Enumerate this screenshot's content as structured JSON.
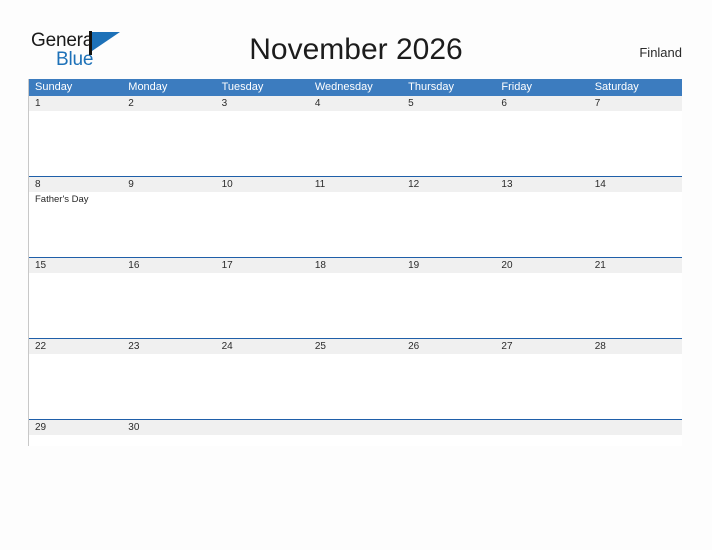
{
  "brand": {
    "name_part1": "General",
    "name_part2": "Blue",
    "logo_icon": "flag-triangle-icon"
  },
  "header": {
    "title": "November 2026",
    "locale": "Finland"
  },
  "calendar": {
    "weekdays": [
      "Sunday",
      "Monday",
      "Tuesday",
      "Wednesday",
      "Thursday",
      "Friday",
      "Saturday"
    ],
    "header_color": "#3c7cbf",
    "row_rule_color": "#1f5fa9",
    "date_band_color": "#f0f0f0",
    "weeks": [
      {
        "days": [
          {
            "date": "1",
            "event": ""
          },
          {
            "date": "2",
            "event": ""
          },
          {
            "date": "3",
            "event": ""
          },
          {
            "date": "4",
            "event": ""
          },
          {
            "date": "5",
            "event": ""
          },
          {
            "date": "6",
            "event": ""
          },
          {
            "date": "7",
            "event": ""
          }
        ]
      },
      {
        "days": [
          {
            "date": "8",
            "event": "Father's Day"
          },
          {
            "date": "9",
            "event": ""
          },
          {
            "date": "10",
            "event": ""
          },
          {
            "date": "11",
            "event": ""
          },
          {
            "date": "12",
            "event": ""
          },
          {
            "date": "13",
            "event": ""
          },
          {
            "date": "14",
            "event": ""
          }
        ]
      },
      {
        "days": [
          {
            "date": "15",
            "event": ""
          },
          {
            "date": "16",
            "event": ""
          },
          {
            "date": "17",
            "event": ""
          },
          {
            "date": "18",
            "event": ""
          },
          {
            "date": "19",
            "event": ""
          },
          {
            "date": "20",
            "event": ""
          },
          {
            "date": "21",
            "event": ""
          }
        ]
      },
      {
        "days": [
          {
            "date": "22",
            "event": ""
          },
          {
            "date": "23",
            "event": ""
          },
          {
            "date": "24",
            "event": ""
          },
          {
            "date": "25",
            "event": ""
          },
          {
            "date": "26",
            "event": ""
          },
          {
            "date": "27",
            "event": ""
          },
          {
            "date": "28",
            "event": ""
          }
        ]
      },
      {
        "days": [
          {
            "date": "29",
            "event": ""
          },
          {
            "date": "30",
            "event": ""
          },
          {
            "date": "",
            "event": ""
          },
          {
            "date": "",
            "event": ""
          },
          {
            "date": "",
            "event": ""
          },
          {
            "date": "",
            "event": ""
          },
          {
            "date": "",
            "event": ""
          }
        ]
      }
    ]
  }
}
